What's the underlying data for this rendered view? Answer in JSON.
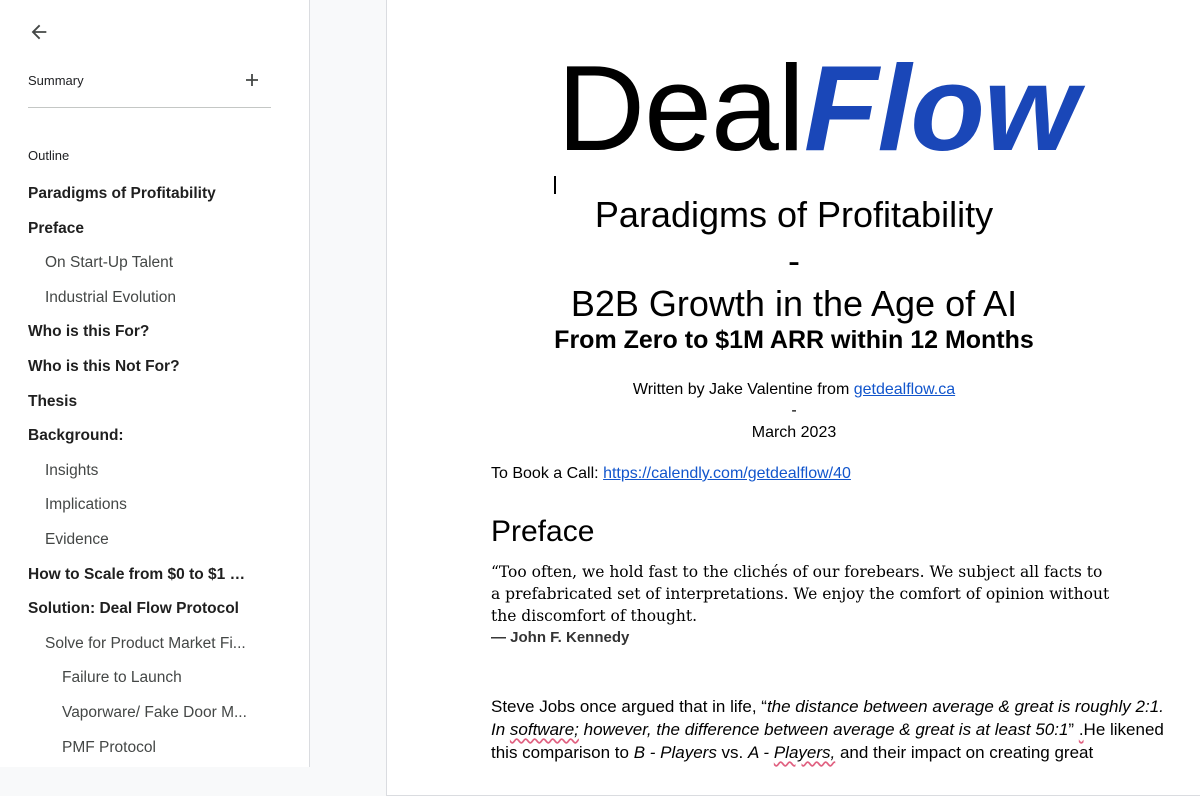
{
  "sidebar": {
    "summary_label": "Summary",
    "outline_label": "Outline",
    "outline": [
      {
        "label": "Paradigms of Profitability",
        "level": 1
      },
      {
        "label": "Preface",
        "level": 1
      },
      {
        "label": "On Start-Up Talent",
        "level": 2
      },
      {
        "label": "Industrial Evolution",
        "level": 2
      },
      {
        "label": "Who is this For?",
        "level": 1
      },
      {
        "label": "Who is this Not For?",
        "level": 1
      },
      {
        "label": "Thesis",
        "level": 1
      },
      {
        "label": "Background:",
        "level": 1
      },
      {
        "label": "Insights",
        "level": 2
      },
      {
        "label": "Implications",
        "level": 2
      },
      {
        "label": "Evidence",
        "level": 2
      },
      {
        "label": "How to Scale from $0 to $1 M...",
        "level": 1
      },
      {
        "label": "Solution: Deal Flow Protocol",
        "level": 1
      },
      {
        "label": "Solve for Product Market Fi...",
        "level": 2
      },
      {
        "label": "Failure to Launch",
        "level": 3
      },
      {
        "label": "Vaporware/ Fake Door M...",
        "level": 3
      },
      {
        "label": "PMF Protocol",
        "level": 3
      }
    ]
  },
  "document": {
    "logo_part1": "Deal",
    "logo_part2": "Flow",
    "title_line1": "Paradigms of Profitability",
    "title_dash": "-",
    "title_line2": "B2B Growth in the Age of AI",
    "subtitle": "From Zero to $1M ARR within 12 Months",
    "author_prefix": "Written by Jake Valentine from ",
    "author_link": "getdealflow.ca",
    "date_dash": "-",
    "date": "March 2023",
    "call_prefix": "To Book a Call: ",
    "call_link": "https://calendly.com/getdealflow/40",
    "preface_heading": "Preface",
    "quote": "“Too often, we hold fast to the clichés of our forebears. We subject all facts to a prefabricated set of interpretations. We enjoy the comfort of opinion without the discomfort of thought.",
    "quote_author": "— John F. Kennedy",
    "para": {
      "t1": "Steve Jobs once argued that in life, “",
      "i1": "the distance between average & great is roughly 2:1. In ",
      "i2": "software;",
      "i3": " however, the difference between average & great is at least 50:1",
      "t2": "” ",
      "t3": ".",
      "t4": "He likened this comparison to ",
      "i4": "B - Players",
      "t5": " vs. ",
      "i5": "A - ",
      "i6": "Players,",
      "t6": " and their impact on creating great"
    }
  },
  "colors": {
    "logo_flow": "#1a47b8",
    "link": "#1155cc",
    "spellcheck": "#e06080"
  }
}
